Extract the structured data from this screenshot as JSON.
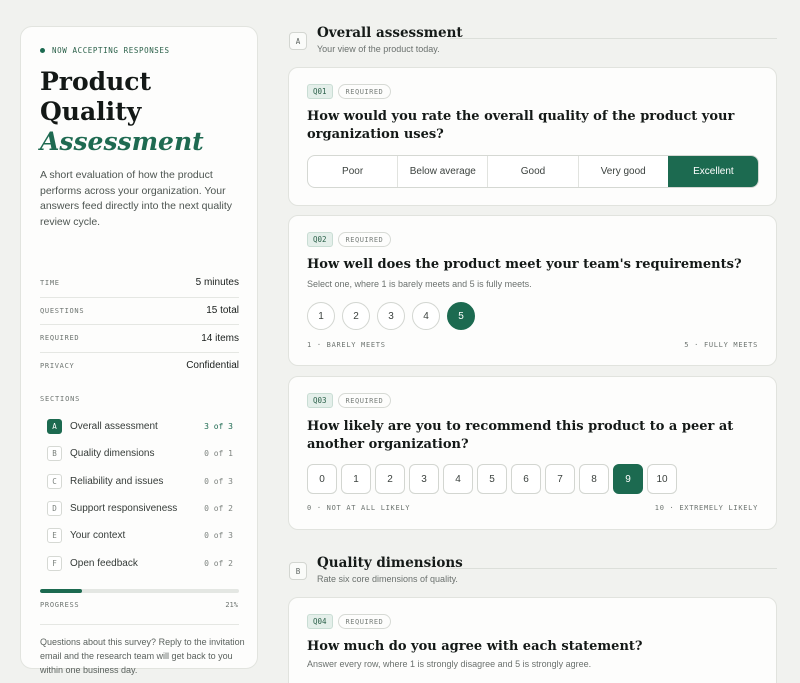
{
  "sidebar": {
    "status": "NOW ACCEPTING RESPONSES",
    "title_line1": "Product",
    "title_line2": "Quality",
    "title_accent": "Assessment",
    "intro": "A short evaluation of how the product performs across your organization. Your answers feed directly into the next quality review cycle.",
    "meta": [
      {
        "key": "TIME",
        "value": "5 minutes"
      },
      {
        "key": "QUESTIONS",
        "value": "15 total"
      },
      {
        "key": "REQUIRED",
        "value": "14 items"
      },
      {
        "key": "PRIVACY",
        "value": "Confidential"
      }
    ],
    "sections_label": "SECTIONS",
    "sections": [
      {
        "letter": "A",
        "name": "Overall assessment",
        "count": "3 of 3",
        "active": true
      },
      {
        "letter": "B",
        "name": "Quality dimensions",
        "count": "0 of 1",
        "active": false
      },
      {
        "letter": "C",
        "name": "Reliability and issues",
        "count": "0 of 3",
        "active": false
      },
      {
        "letter": "D",
        "name": "Support responsiveness",
        "count": "0 of 2",
        "active": false
      },
      {
        "letter": "E",
        "name": "Your context",
        "count": "0 of 3",
        "active": false
      },
      {
        "letter": "F",
        "name": "Open feedback",
        "count": "0 of 2",
        "active": false
      }
    ],
    "progress_label": "PROGRESS",
    "progress_value": "21%",
    "progress_fraction": 0.21,
    "help": "Questions about this survey? Reply to the invitation email and the research team will get back to you within one business day."
  },
  "section_a": {
    "letter": "A",
    "title": "Overall assessment",
    "subtitle": "Your view of the product today."
  },
  "section_b": {
    "letter": "B",
    "title": "Quality dimensions",
    "subtitle": "Rate six core dimensions of quality."
  },
  "q1": {
    "num": "Q01",
    "required": "REQUIRED",
    "text": "How would you rate the overall quality of the product your organization uses?",
    "options": [
      "Poor",
      "Below average",
      "Good",
      "Very good",
      "Excellent"
    ],
    "selected": "Excellent"
  },
  "q2": {
    "num": "Q02",
    "required": "REQUIRED",
    "text": "How well does the product meet your team's requirements?",
    "help": "Select one, where 1 is barely meets and 5 is fully meets.",
    "options": [
      "1",
      "2",
      "3",
      "4",
      "5"
    ],
    "selected": "5",
    "low_label": "1 · BARELY MEETS",
    "high_label": "5 · FULLY MEETS"
  },
  "q3": {
    "num": "Q03",
    "required": "REQUIRED",
    "text": "How likely are you to recommend this product to a peer at another organization?",
    "options": [
      "0",
      "1",
      "2",
      "3",
      "4",
      "5",
      "6",
      "7",
      "8",
      "9",
      "10"
    ],
    "selected": "9",
    "low_label": "0 · NOT AT ALL LIKELY",
    "high_label": "10 · EXTREMELY LIKELY"
  },
  "q4": {
    "num": "Q04",
    "required": "REQUIRED",
    "text": "How much do you agree with each statement?",
    "help": "Answer every row, where 1 is strongly disagree and 5 is strongly agree."
  },
  "colors": {
    "accent": "#1c6a50",
    "background": "#f1f2ef",
    "card": "#fdfdfc"
  }
}
